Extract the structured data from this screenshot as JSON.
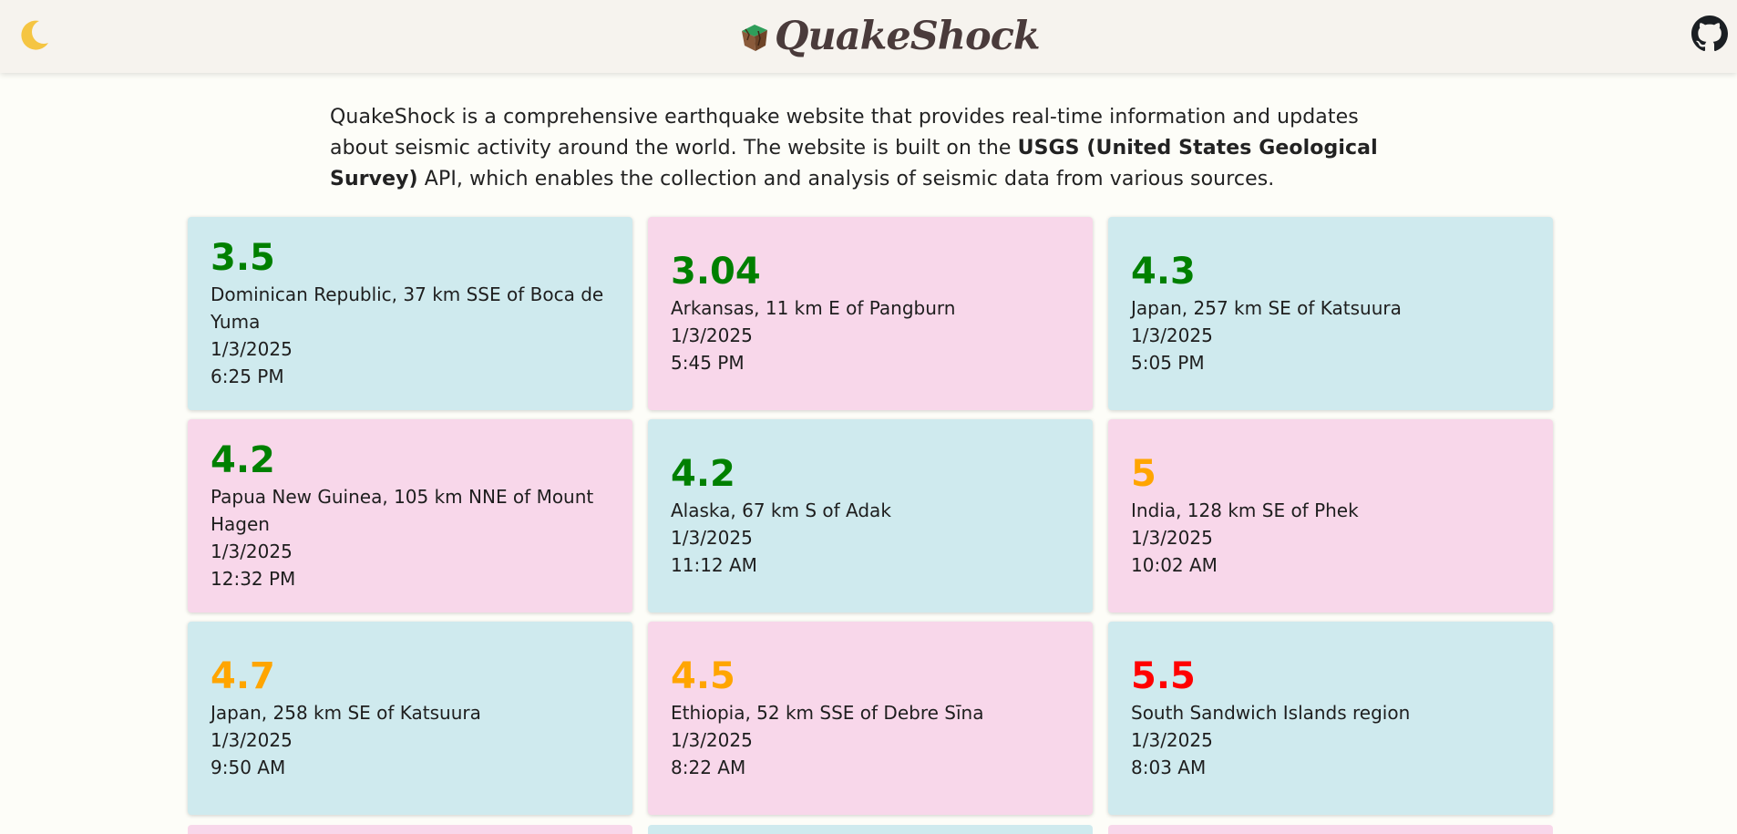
{
  "header": {
    "brand_name": "QuakeShock",
    "theme_toggle_icon": "crescent-moon-icon",
    "github_icon": "github-icon"
  },
  "intro": {
    "part1": "QuakeShock is a comprehensive earthquake website that provides real-time information and updates about seismic activity around the world. The website is built on the ",
    "bold": "USGS (United States Geological Survey)",
    "part2": " API, which enables the collection and analysis of seismic data from various sources."
  },
  "colors": {
    "mag_low": "#008000",
    "mag_mid": "#ffa500",
    "mag_high": "#ff0000",
    "card_blue": "#cfeaee",
    "card_pink": "#f8d7ea"
  },
  "quakes": [
    {
      "mag": "3.5",
      "place": "Dominican Republic, 37 km SSE of Boca de Yuma",
      "date": "1/3/2025",
      "time": "6:25 PM",
      "level": "low",
      "bg": "blue"
    },
    {
      "mag": "3.04",
      "place": "Arkansas, 11 km E of Pangburn",
      "date": "1/3/2025",
      "time": "5:45 PM",
      "level": "low",
      "bg": "pink"
    },
    {
      "mag": "4.3",
      "place": "Japan, 257 km SE of Katsuura",
      "date": "1/3/2025",
      "time": "5:05 PM",
      "level": "low",
      "bg": "blue"
    },
    {
      "mag": "4.2",
      "place": "Papua New Guinea, 105 km NNE of Mount Hagen",
      "date": "1/3/2025",
      "time": "12:32 PM",
      "level": "low",
      "bg": "pink"
    },
    {
      "mag": "4.2",
      "place": "Alaska, 67 km S of Adak",
      "date": "1/3/2025",
      "time": "11:12 AM",
      "level": "low",
      "bg": "blue"
    },
    {
      "mag": "5",
      "place": "India, 128 km SE of Phek",
      "date": "1/3/2025",
      "time": "10:02 AM",
      "level": "mid",
      "bg": "pink"
    },
    {
      "mag": "4.7",
      "place": "Japan, 258 km SE of Katsuura",
      "date": "1/3/2025",
      "time": "9:50 AM",
      "level": "mid",
      "bg": "blue"
    },
    {
      "mag": "4.5",
      "place": "Ethiopia, 52 km SSE of Debre Sīna",
      "date": "1/3/2025",
      "time": "8:22 AM",
      "level": "mid",
      "bg": "pink"
    },
    {
      "mag": "5.5",
      "place": "South Sandwich Islands region",
      "date": "1/3/2025",
      "time": "8:03 AM",
      "level": "high",
      "bg": "blue"
    }
  ]
}
